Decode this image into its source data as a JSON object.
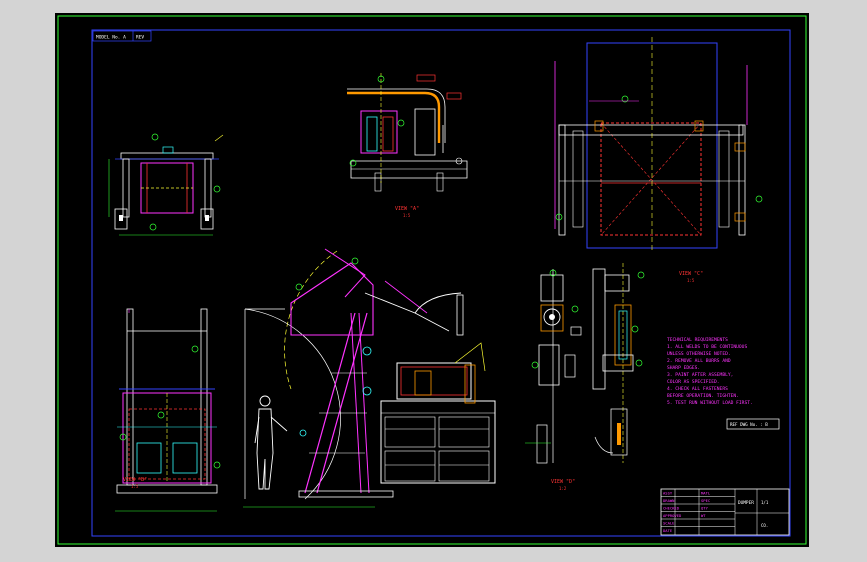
{
  "viewport": {
    "background": "#000000",
    "frame_color": "#00cc33",
    "border_color": "#3344ff"
  },
  "colors": {
    "blue": "#3344ff",
    "white": "#ffffff",
    "red": "#ff3333",
    "magenta": "#ff33ff",
    "yellow": "#ffff33",
    "cyan": "#33ffff",
    "green": "#33ff33",
    "orange": "#ff9900"
  },
  "labels": {
    "top_left_box": "MODEL No. A",
    "top_left_tag": "REV",
    "view_a": "VIEW \"A\"",
    "view_a_scale": "1:5",
    "view_b": "VIEW \"B\"",
    "view_b_scale": "1:5",
    "view_d": "VIEW \"D\"",
    "view_d_scale": "1:2",
    "view_c": "VIEW \"C\"",
    "view_c_scale": "1:5",
    "ref_box": "REF DWG No. : B"
  },
  "notes": [
    "TECHNICAL REQUIREMENTS",
    "1. ALL WELDS TO BE CONTINUOUS",
    "   UNLESS OTHERWISE NOTED.",
    "2. REMOVE ALL BURRS AND",
    "   SHARP EDGES.",
    "3. PAINT AFTER ASSEMBLY,",
    "   COLOR AS SPECIFIED.",
    "4. CHECK ALL FASTENERS",
    "   BEFORE OPERATION. TIGHTEN.",
    "5. TEST RUN WITHOUT LOAD FIRST."
  ],
  "title_block": {
    "rows": [
      "ASSY",
      "DRAWN",
      "CHECKED",
      "APPROVED",
      "SCALE",
      "DATE"
    ],
    "col2": [
      "MATL",
      "SPEC",
      "QTY",
      "WT"
    ],
    "name": "DUMPER",
    "sheet": "1/1",
    "company": "CO."
  }
}
